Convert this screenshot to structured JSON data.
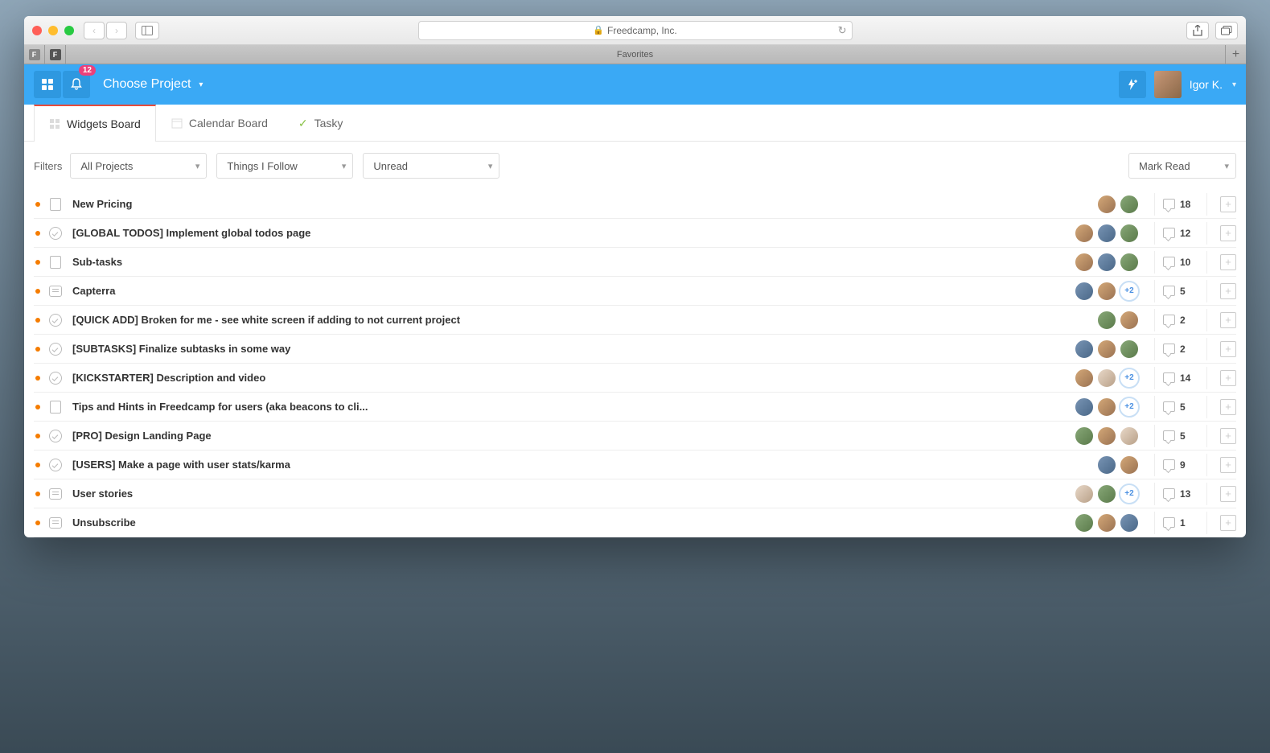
{
  "browser": {
    "address": "Freedcamp, Inc.",
    "favorites_label": "Favorites"
  },
  "header": {
    "notification_count": "12",
    "project_selector": "Choose Project",
    "user_name": "Igor K."
  },
  "view_tabs": [
    {
      "label": "Widgets Board",
      "active": true,
      "icon": "grid"
    },
    {
      "label": "Calendar Board",
      "active": false,
      "icon": "calendar"
    },
    {
      "label": "Tasky",
      "active": false,
      "icon": "check"
    }
  ],
  "filters": {
    "label": "Filters",
    "projects": "All Projects",
    "follow": "Things I Follow",
    "unread": "Unread",
    "mark": "Mark Read"
  },
  "items": [
    {
      "type": "note",
      "title": "New Pricing",
      "avatars": [
        "a1",
        "a3"
      ],
      "more": null,
      "comments": "18"
    },
    {
      "type": "task",
      "title": "[GLOBAL TODOS] Implement global todos page",
      "avatars": [
        "a1",
        "a2",
        "a3"
      ],
      "more": null,
      "comments": "12"
    },
    {
      "type": "note",
      "title": "Sub-tasks",
      "avatars": [
        "a1",
        "a2",
        "a3"
      ],
      "more": null,
      "comments": "10"
    },
    {
      "type": "disc",
      "title": "Capterra",
      "avatars": [
        "a2",
        "a1"
      ],
      "more": "+2",
      "comments": "5"
    },
    {
      "type": "task",
      "title": "[QUICK ADD] Broken for me - see white screen if adding to not current project",
      "avatars": [
        "a3",
        "a1"
      ],
      "more": null,
      "comments": "2"
    },
    {
      "type": "task",
      "title": "[SUBTASKS] Finalize subtasks in some way",
      "avatars": [
        "a2",
        "a1",
        "a3"
      ],
      "more": null,
      "comments": "2"
    },
    {
      "type": "task",
      "title": "[KICKSTARTER] Description and video",
      "avatars": [
        "a1",
        "a4"
      ],
      "more": "+2",
      "comments": "14"
    },
    {
      "type": "note",
      "title": "Tips and Hints in Freedcamp for users (aka beacons to cli...",
      "avatars": [
        "a2",
        "a1"
      ],
      "more": "+2",
      "comments": "5"
    },
    {
      "type": "task",
      "title": "[PRO] Design Landing Page",
      "avatars": [
        "a3",
        "a1",
        "a4"
      ],
      "more": null,
      "comments": "5"
    },
    {
      "type": "task",
      "title": "[USERS] Make a page with user stats/karma",
      "avatars": [
        "a2",
        "a1"
      ],
      "more": null,
      "comments": "9"
    },
    {
      "type": "disc",
      "title": "User stories",
      "avatars": [
        "a4",
        "a3"
      ],
      "more": "+2",
      "comments": "13"
    },
    {
      "type": "disc",
      "title": "Unsubscribe",
      "avatars": [
        "a3",
        "a1",
        "a2"
      ],
      "more": null,
      "comments": "1"
    }
  ]
}
